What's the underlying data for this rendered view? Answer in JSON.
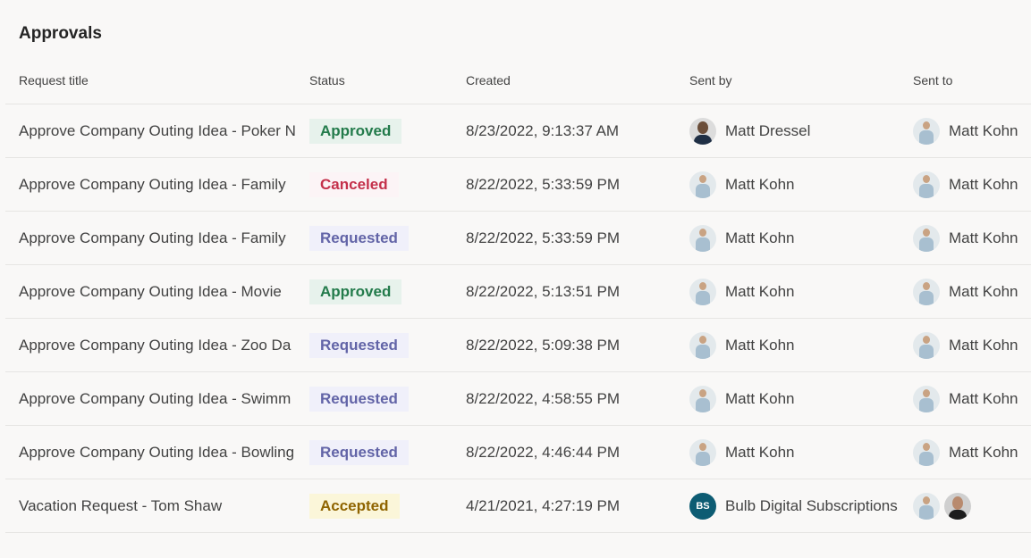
{
  "page": {
    "title": "Approvals"
  },
  "columns": {
    "title": "Request title",
    "status": "Status",
    "created": "Created",
    "sent_by": "Sent by",
    "sent_to": "Sent to"
  },
  "status_styles": {
    "Approved": {
      "color": "#237b4b",
      "background": "#e7f2ec"
    },
    "Canceled": {
      "color": "#c4314b",
      "background": "#fcf4f6"
    },
    "Requested": {
      "color": "#6264a7",
      "background": "#f0f0fa"
    },
    "Accepted": {
      "color": "#8f6400",
      "background": "#fbf6d9"
    }
  },
  "rows": [
    {
      "title": "Approve Company Outing Idea - Poker N",
      "status": "Approved",
      "created": "8/23/2022, 9:13:37 AM",
      "sent_by": {
        "name": "Matt Dressel",
        "avatar": "dark"
      },
      "sent_to": [
        {
          "name": "Matt Kohn",
          "avatar": "light"
        }
      ]
    },
    {
      "title": "Approve Company Outing Idea - Family",
      "status": "Canceled",
      "created": "8/22/2022, 5:33:59 PM",
      "sent_by": {
        "name": "Matt Kohn",
        "avatar": "light"
      },
      "sent_to": [
        {
          "name": "Matt Kohn",
          "avatar": "light"
        }
      ]
    },
    {
      "title": "Approve Company Outing Idea - Family",
      "status": "Requested",
      "created": "8/22/2022, 5:33:59 PM",
      "sent_by": {
        "name": "Matt Kohn",
        "avatar": "light"
      },
      "sent_to": [
        {
          "name": "Matt Kohn",
          "avatar": "light"
        }
      ]
    },
    {
      "title": "Approve Company Outing Idea - Movie",
      "status": "Approved",
      "created": "8/22/2022, 5:13:51 PM",
      "sent_by": {
        "name": "Matt Kohn",
        "avatar": "light"
      },
      "sent_to": [
        {
          "name": "Matt Kohn",
          "avatar": "light"
        }
      ]
    },
    {
      "title": "Approve Company Outing Idea - Zoo Da",
      "status": "Requested",
      "created": "8/22/2022, 5:09:38 PM",
      "sent_by": {
        "name": "Matt Kohn",
        "avatar": "light"
      },
      "sent_to": [
        {
          "name": "Matt Kohn",
          "avatar": "light"
        }
      ]
    },
    {
      "title": "Approve Company Outing Idea - Swimm",
      "status": "Requested",
      "created": "8/22/2022, 4:58:55 PM",
      "sent_by": {
        "name": "Matt Kohn",
        "avatar": "light"
      },
      "sent_to": [
        {
          "name": "Matt Kohn",
          "avatar": "light"
        }
      ]
    },
    {
      "title": "Approve Company Outing Idea - Bowling",
      "status": "Requested",
      "created": "8/22/2022, 4:46:44 PM",
      "sent_by": {
        "name": "Matt Kohn",
        "avatar": "light"
      },
      "sent_to": [
        {
          "name": "Matt Kohn",
          "avatar": "light"
        }
      ]
    },
    {
      "title": "Vacation Request - Tom Shaw",
      "status": "Accepted",
      "created": "4/21/2021, 4:27:19 PM",
      "sent_by": {
        "name": "Bulb Digital Subscriptions",
        "avatar": "initials",
        "initials": "BS",
        "color": "#0d5c73"
      },
      "sent_to": [
        {
          "name": "",
          "avatar": "light"
        },
        {
          "name": "",
          "avatar": "bald"
        }
      ]
    }
  ]
}
